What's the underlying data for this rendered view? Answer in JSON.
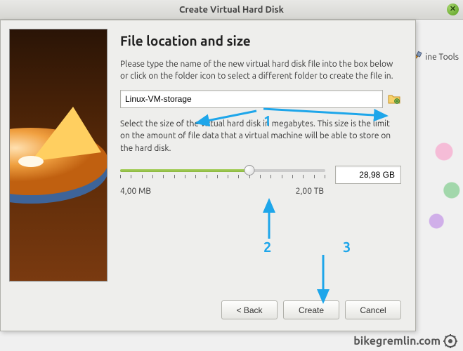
{
  "window": {
    "title": "Create Virtual Hard Disk"
  },
  "page": {
    "heading": "File location and size",
    "desc1": "Please type the name of the new virtual hard disk file into the box below or click on the folder icon to select a different folder to create the file in.",
    "desc2": "Select the size of the virtual hard disk in megabytes. This size is the limit on the amount of file data that a virtual machine will be able to store on the hard disk."
  },
  "form": {
    "path_value": "Linux-VM-storage",
    "size_value": "28,98 GB",
    "range_min": "4,00 MB",
    "range_max": "2,00 TB"
  },
  "buttons": {
    "back": "< Back",
    "create": "Create",
    "cancel": "Cancel"
  },
  "background": {
    "tools_label": "ine Tools"
  },
  "annotations": {
    "n1": "1",
    "n2": "2",
    "n3": "3"
  },
  "watermark": "bikegremlin.com"
}
